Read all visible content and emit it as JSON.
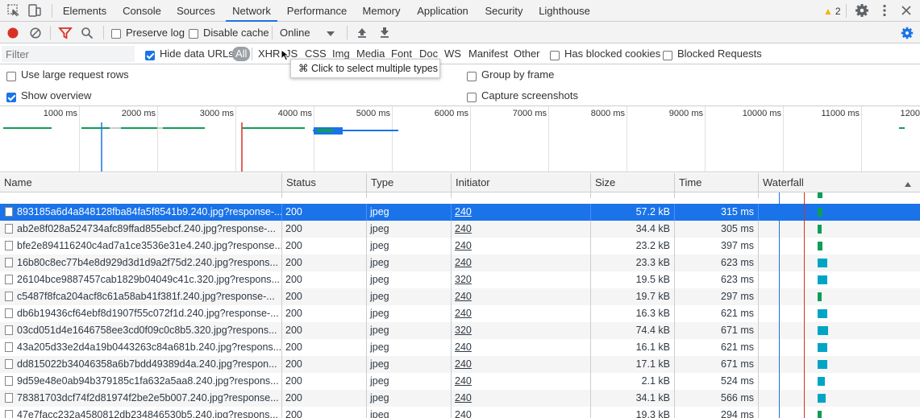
{
  "tabs": [
    "Elements",
    "Console",
    "Sources",
    "Network",
    "Performance",
    "Memory",
    "Application",
    "Security",
    "Lighthouse"
  ],
  "active_tab": "Network",
  "warnings_count": "2",
  "toolbar": {
    "preserve_log": "Preserve log",
    "disable_cache": "Disable cache",
    "throttle": "Online"
  },
  "filter": {
    "placeholder": "Filter",
    "hide_data_urls": "Hide data URLs",
    "types": [
      "All",
      "XHR",
      "JS",
      "CSS",
      "Img",
      "Media",
      "Font",
      "Doc",
      "WS",
      "Manifest",
      "Other"
    ],
    "has_blocked_cookies": "Has blocked cookies",
    "blocked_requests": "Blocked Requests"
  },
  "tooltip": "⌘ Click to select multiple types",
  "settings": {
    "large_rows": "Use large request rows",
    "show_overview": "Show overview",
    "group_by_frame": "Group by frame",
    "capture_screenshots": "Capture screenshots"
  },
  "overview_ticks": [
    "1000 ms",
    "2000 ms",
    "3000 ms",
    "4000 ms",
    "5000 ms",
    "6000 ms",
    "7000 ms",
    "8000 ms",
    "9000 ms",
    "10000 ms",
    "11000 ms",
    "1200"
  ],
  "columns": [
    "Name",
    "Status",
    "Type",
    "Initiator",
    "Size",
    "Time",
    "Waterfall"
  ],
  "rows": [
    {
      "name": "893185a6d4a848128fba84fa5f8541b9.240.jpg?response-...",
      "status": "200",
      "type": "jpeg",
      "initiator": "240",
      "size": "57.2 kB",
      "time": "315 ms"
    },
    {
      "name": "ab2e8f028a524734afc89ffad855ebcf.240.jpg?response-...",
      "status": "200",
      "type": "jpeg",
      "initiator": "240",
      "size": "34.4 kB",
      "time": "305 ms"
    },
    {
      "name": "bfe2e894116240c4ad7a1ce3536e31e4.240.jpg?response...",
      "status": "200",
      "type": "jpeg",
      "initiator": "240",
      "size": "23.2 kB",
      "time": "397 ms"
    },
    {
      "name": "16b80c8ec77b4e8d929d3d1d9a2f75d2.240.jpg?respons...",
      "status": "200",
      "type": "jpeg",
      "initiator": "240",
      "size": "23.3 kB",
      "time": "623 ms"
    },
    {
      "name": "26104bce9887457cab1829b04049c41c.320.jpg?respons...",
      "status": "200",
      "type": "jpeg",
      "initiator": "320",
      "size": "19.5 kB",
      "time": "623 ms"
    },
    {
      "name": "c5487f8fca204acf8c61a58ab41f381f.240.jpg?response-...",
      "status": "200",
      "type": "jpeg",
      "initiator": "240",
      "size": "19.7 kB",
      "time": "297 ms"
    },
    {
      "name": "db6b19436cf64ebf8d1907f55c072f1d.240.jpg?response-...",
      "status": "200",
      "type": "jpeg",
      "initiator": "240",
      "size": "16.3 kB",
      "time": "621 ms"
    },
    {
      "name": "03cd051d4e1646758ee3cd0f09c0c8b5.320.jpg?respons...",
      "status": "200",
      "type": "jpeg",
      "initiator": "320",
      "size": "74.4 kB",
      "time": "671 ms"
    },
    {
      "name": "43a205d33e2d4a19b0443263c84a681b.240.jpg?respons...",
      "status": "200",
      "type": "jpeg",
      "initiator": "240",
      "size": "16.1 kB",
      "time": "621 ms"
    },
    {
      "name": "dd815022b34046358a6b7bdd49389d4a.240.jpg?respon...",
      "status": "200",
      "type": "jpeg",
      "initiator": "240",
      "size": "17.1 kB",
      "time": "671 ms"
    },
    {
      "name": "9d59e48e0ab94b379185c1fa632a5aa8.240.jpg?respons...",
      "status": "200",
      "type": "jpeg",
      "initiator": "240",
      "size": "2.1 kB",
      "time": "524 ms"
    },
    {
      "name": "78381703dcf74f2d81974f2be2e5b007.240.jpg?response...",
      "status": "200",
      "type": "jpeg",
      "initiator": "240",
      "size": "34.1 kB",
      "time": "566 ms"
    },
    {
      "name": "47e7facc232a4580812db234846530b5.240.jpg?respons...",
      "status": "200",
      "type": "jpeg",
      "initiator": "240",
      "size": "19.3 kB",
      "time": "294 ms"
    }
  ],
  "colors": {
    "accent": "#1a73e8",
    "record": "#d93025",
    "green": "#0f9d58",
    "teal": "#00a5c6"
  }
}
